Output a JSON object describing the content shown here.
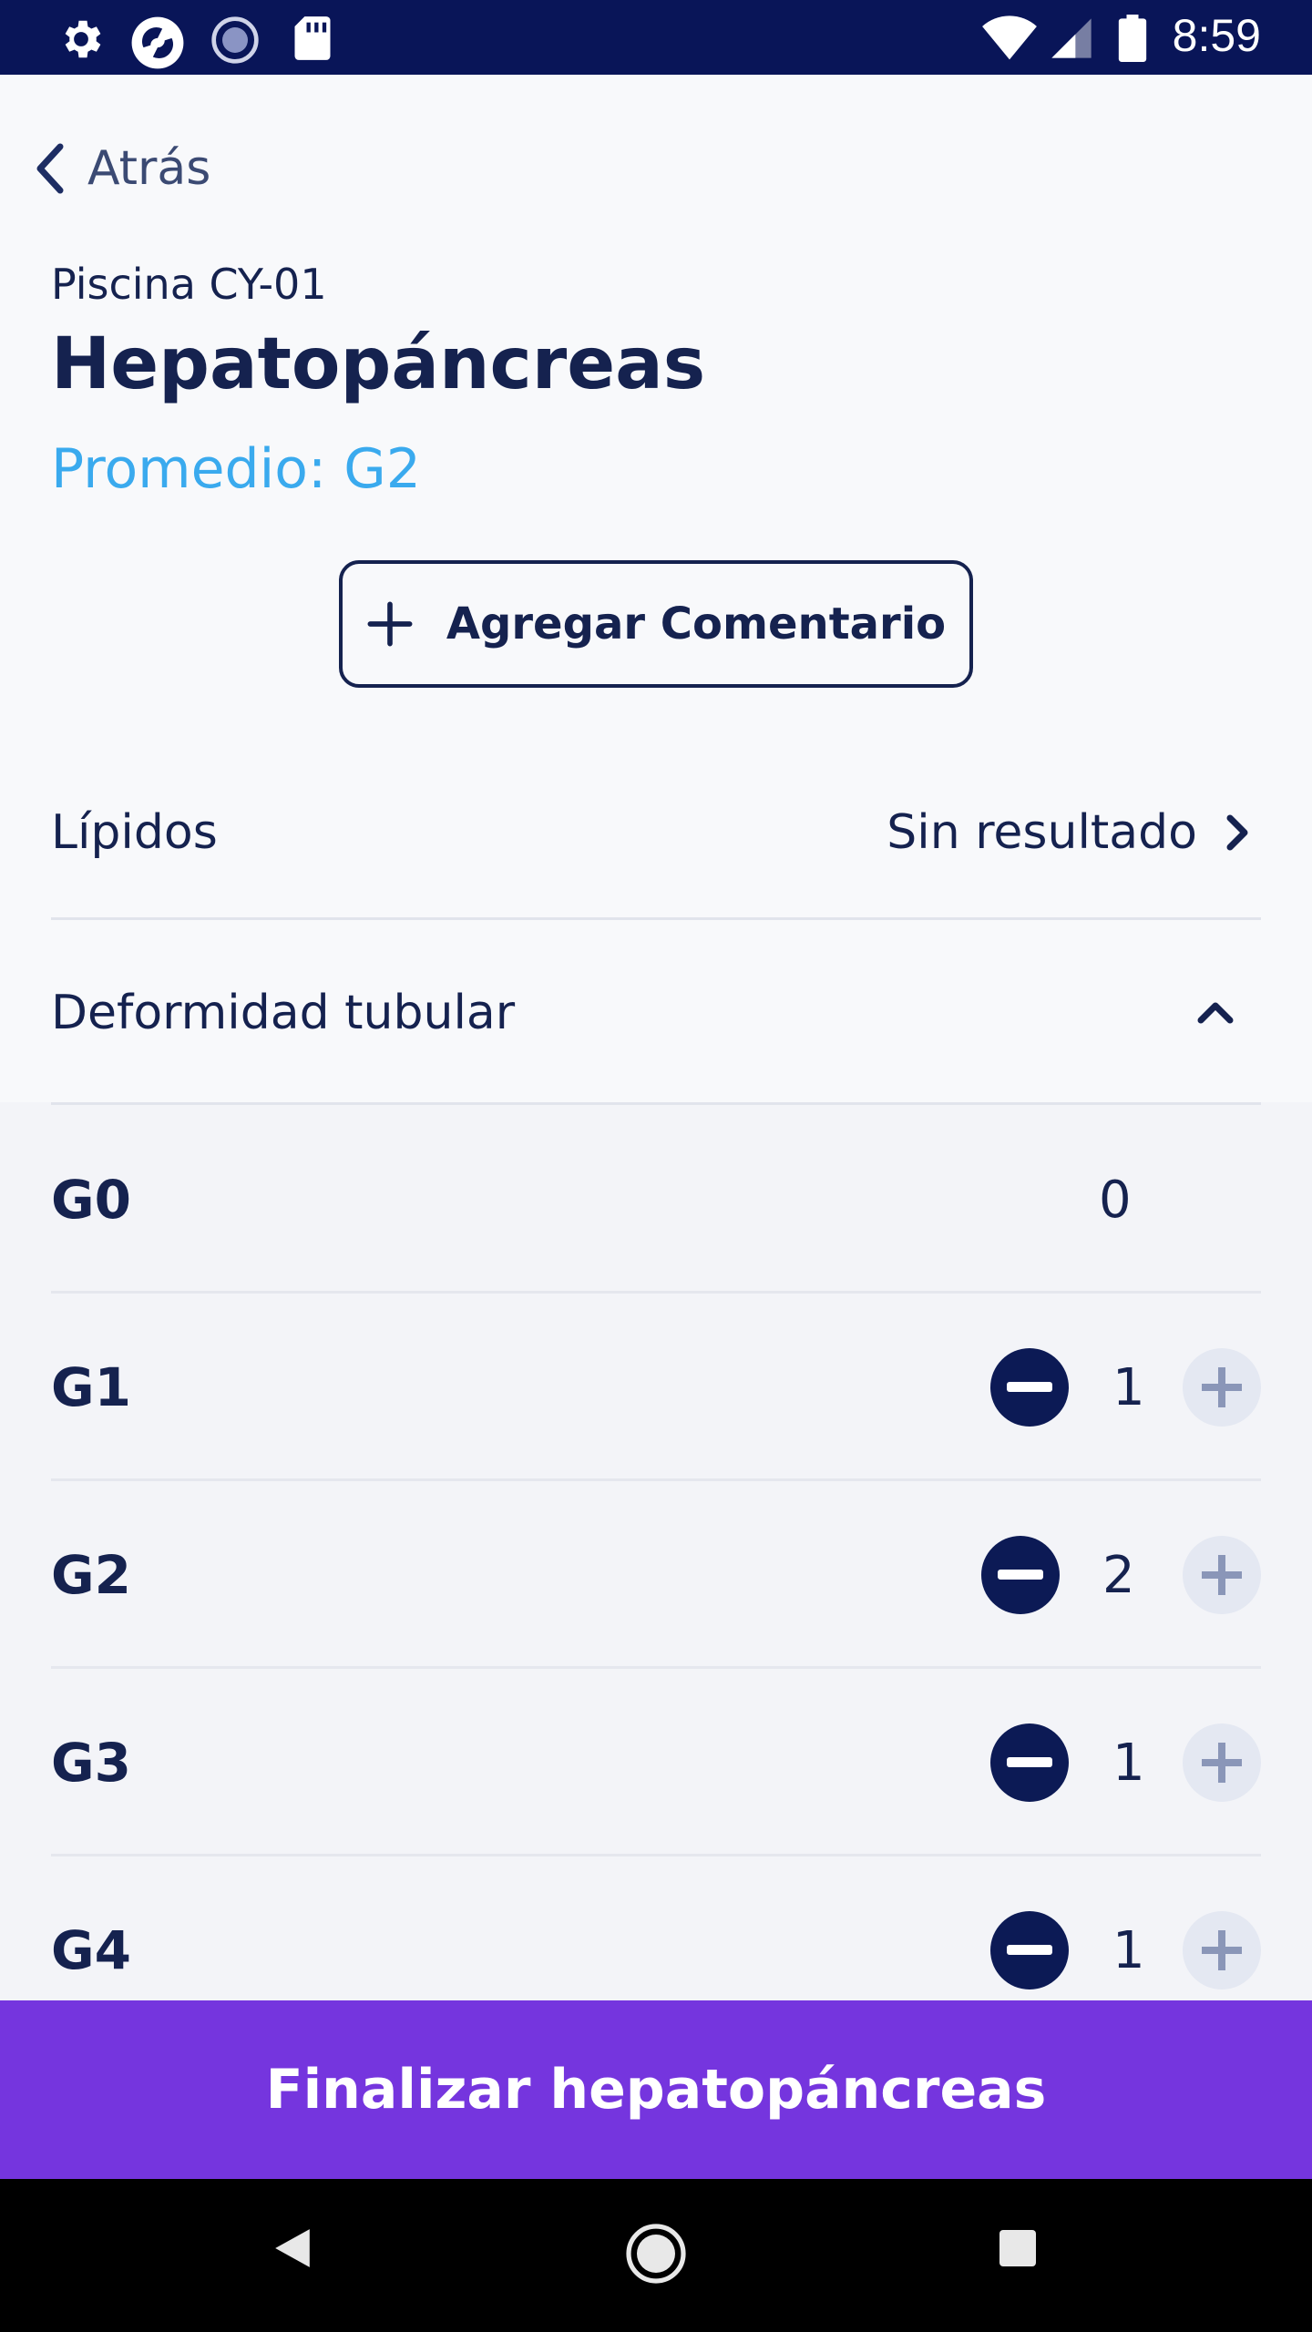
{
  "status_bar": {
    "time": "8:59",
    "icons": [
      "settings-icon",
      "app-icon",
      "sync-icon",
      "sd-card-icon",
      "wifi-icon",
      "signal-icon",
      "battery-icon"
    ]
  },
  "nav": {
    "back_label": "Atrás"
  },
  "header": {
    "pool": "Piscina CY-01",
    "title": "Hepatopáncreas",
    "average": "Promedio: G2"
  },
  "actions": {
    "add_comment_label": "Agregar Comentario"
  },
  "sections": {
    "lipids": {
      "label": "Lípidos",
      "value": "Sin resultado"
    },
    "tubular": {
      "label": "Deformidad tubular"
    }
  },
  "grades": [
    {
      "label": "G0",
      "count": "0"
    },
    {
      "label": "G1",
      "count": "1"
    },
    {
      "label": "G2",
      "count": "2"
    },
    {
      "label": "G3",
      "count": "1"
    },
    {
      "label": "G4",
      "count": "1"
    }
  ],
  "footer": {
    "finish_label": "Finalizar hepatopáncreas"
  },
  "colors": {
    "status_bar": "#091558",
    "text_primary": "#15224f",
    "accent_blue": "#3aaaee",
    "finish_button": "#7535de"
  }
}
